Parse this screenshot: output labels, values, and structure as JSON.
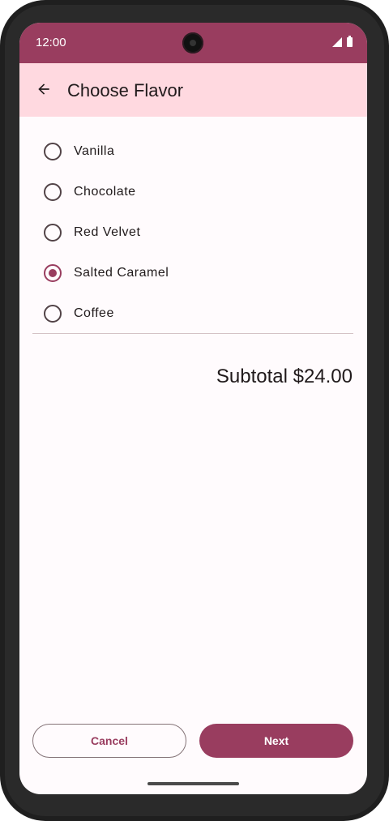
{
  "status_bar": {
    "time": "12:00",
    "icons": [
      "signal-icon",
      "battery-icon"
    ]
  },
  "app_bar": {
    "title": "Choose Flavor",
    "back_icon": "arrow-back-icon"
  },
  "flavors": {
    "selected": "Salted Caramel",
    "options": [
      {
        "label": "Vanilla",
        "checked": false
      },
      {
        "label": "Chocolate",
        "checked": false
      },
      {
        "label": "Red Velvet",
        "checked": false
      },
      {
        "label": "Salted Caramel",
        "checked": true
      },
      {
        "label": "Coffee",
        "checked": false
      }
    ]
  },
  "subtotal": "Subtotal $24.00",
  "actions": {
    "cancel_label": "Cancel",
    "next_label": "Next"
  },
  "colors": {
    "primary": "#993d5f",
    "app_bar_bg": "#ffd9e0",
    "surface": "#fffbfd"
  }
}
